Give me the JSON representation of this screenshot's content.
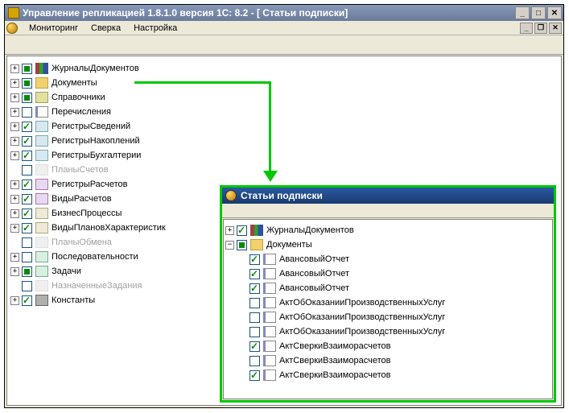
{
  "window": {
    "title": "Управление репликацией 1.8.1.0  версия 1С: 8.2 - [ Статьи подписки]"
  },
  "menu": {
    "monitoring": "Мониторинг",
    "sverka": "Сверка",
    "nastroika": "Настройка"
  },
  "tree": [
    {
      "chk": "full",
      "icon": "books",
      "label": "ЖурналыДокументов",
      "expand": "+"
    },
    {
      "chk": "full",
      "icon": "folder",
      "label": "Документы",
      "expand": "+"
    },
    {
      "chk": "full",
      "icon": "ref",
      "label": "Справочники",
      "expand": "+"
    },
    {
      "chk": "empty",
      "icon": "doc",
      "label": "Перечисления",
      "expand": "+"
    },
    {
      "chk": "check",
      "icon": "reg",
      "label": "РегистрыСведений",
      "expand": "+"
    },
    {
      "chk": "check",
      "icon": "reg",
      "label": "РегистрыНакоплений",
      "expand": "+"
    },
    {
      "chk": "check",
      "icon": "reg",
      "label": "РегистрыБухгалтерии",
      "expand": "+"
    },
    {
      "chk": "empty",
      "icon": "disabled",
      "label": "ПланыСчетов",
      "expand": "",
      "disabled": true
    },
    {
      "chk": "check",
      "icon": "calc",
      "label": "РегистрыРасчетов",
      "expand": "+"
    },
    {
      "chk": "check",
      "icon": "calc",
      "label": "ВидыРасчетов",
      "expand": "+"
    },
    {
      "chk": "check",
      "icon": "biz",
      "label": "БизнесПроцессы",
      "expand": "+"
    },
    {
      "chk": "check",
      "icon": "biz",
      "label": "ВидыПлановХарактеристик",
      "expand": "+"
    },
    {
      "chk": "empty",
      "icon": "disabled",
      "label": "ПланыОбмена",
      "expand": "",
      "disabled": true
    },
    {
      "chk": "empty",
      "icon": "task",
      "label": "Последовательности",
      "expand": "+"
    },
    {
      "chk": "full",
      "icon": "task",
      "label": "Задачи",
      "expand": "+"
    },
    {
      "chk": "empty",
      "icon": "disabled",
      "label": "НазначенныеЗадания",
      "expand": "",
      "disabled": true
    },
    {
      "chk": "check",
      "icon": "const",
      "label": "Константы",
      "expand": "+"
    }
  ],
  "popup": {
    "title": "Статьи подписки",
    "items": [
      {
        "chk": "check",
        "icon": "books",
        "label": "ЖурналыДокументов",
        "expand": "+",
        "level": 0
      },
      {
        "chk": "full",
        "icon": "folder",
        "label": "Документы",
        "expand": "-",
        "level": 0
      },
      {
        "chk": "check",
        "icon": "doc",
        "label": "АвансовыйОтчет",
        "level": 1
      },
      {
        "chk": "check",
        "icon": "doc",
        "label": "АвансовыйОтчет",
        "level": 1
      },
      {
        "chk": "check",
        "icon": "doc",
        "label": "АвансовыйОтчет",
        "level": 1
      },
      {
        "chk": "empty",
        "icon": "doc",
        "label": "АктОбОказанииПроизводственныхУслуг",
        "level": 1
      },
      {
        "chk": "empty",
        "icon": "doc",
        "label": "АктОбОказанииПроизводственныхУслуг",
        "level": 1
      },
      {
        "chk": "empty",
        "icon": "doc",
        "label": "АктОбОказанииПроизводственныхУслуг",
        "level": 1
      },
      {
        "chk": "check",
        "icon": "doc",
        "label": "АктСверкиВзаиморасчетов",
        "level": 1
      },
      {
        "chk": "empty",
        "icon": "doc",
        "label": "АктСверкиВзаиморасчетов",
        "level": 1
      },
      {
        "chk": "check",
        "icon": "doc",
        "label": "АктСверкиВзаиморасчетов",
        "level": 1
      }
    ]
  }
}
